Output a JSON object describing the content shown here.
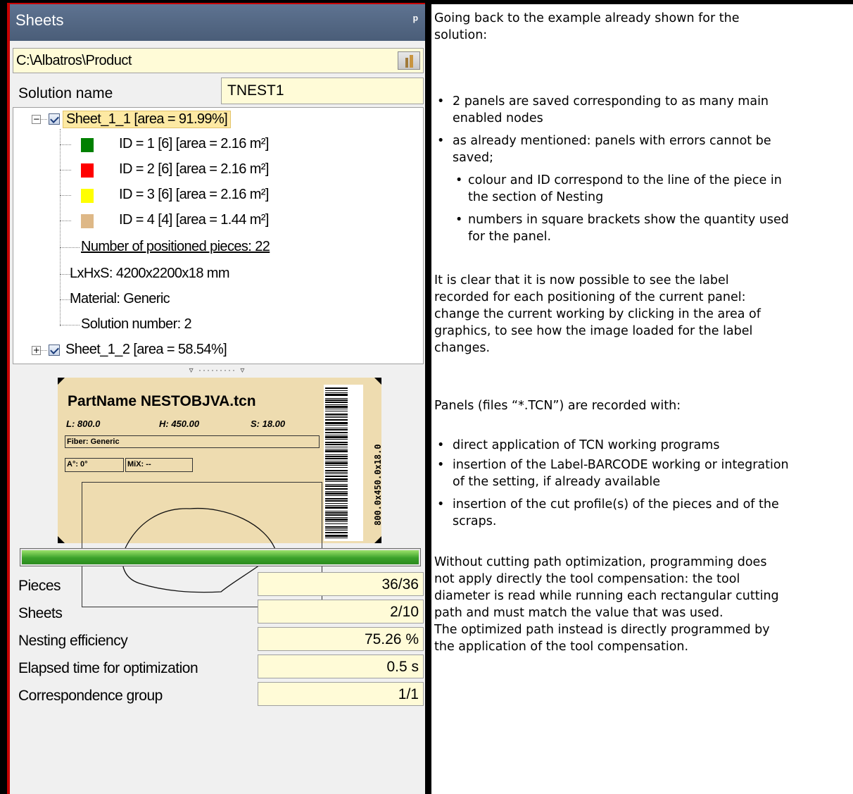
{
  "panel": {
    "title": "Sheets",
    "pin_icon": "pin-icon",
    "path": "C:\\Albatros\\Product",
    "solution_name_label": "Solution name",
    "solution_name_value": "TNEST1",
    "tree": {
      "sheet1": "Sheet_1_1 [area = 91.99%]",
      "pieces": [
        {
          "label": "ID = 1 [6] [area = 2.16 m²]",
          "color": "#008000"
        },
        {
          "label": "ID = 2 [6] [area = 2.16 m²]",
          "color": "#ff0000"
        },
        {
          "label": "ID = 3 [6] [area = 2.16 m²]",
          "color": "#ffff00"
        },
        {
          "label": "ID = 4 [4] [area = 1.44 m²]",
          "color": "#deb887"
        }
      ],
      "positioned": "Number of positioned pieces: 22",
      "lxhxs": "LxHxS: 4200x2200x18  mm",
      "material": "Material: Generic",
      "solution_number": "Solution number: 2",
      "sheet2": "Sheet_1_2 [area = 58.54%]"
    },
    "label_preview": {
      "part_name": "PartName NESTOBJVA.tcn",
      "l": "L: 800.0",
      "h": "H: 450.00",
      "s": "S: 18.00",
      "fiber": "Fiber: Generic",
      "angle": "A°: 0°",
      "mix": "MiX: --",
      "barcode_text": "800.0x450.0x18.0"
    },
    "progress": 1.0,
    "stats": [
      {
        "label": "Pieces",
        "value": "36/36"
      },
      {
        "label": "Sheets",
        "value": "2/10"
      },
      {
        "label": "Nesting efficiency",
        "value": "75.26 %"
      },
      {
        "label": "Elapsed time for optimization",
        "value": "0.5 s"
      },
      {
        "label": "Correspondence group",
        "value": "1/1"
      }
    ]
  },
  "doc": {
    "intro_1": "Going back to the example already shown for the",
    "intro_2": "solution:",
    "b1_1": "2 panels are saved corresponding to as many main",
    "b1_2": "enabled nodes",
    "b2_1": "as already mentioned: panels with errors cannot be",
    "b2_2": "saved;",
    "s1_1": "colour and ID correspond to the line of the piece in",
    "s1_2": "the section of Nesting",
    "s2_1": "numbers in square brackets show the quantity used",
    "s2_2": "for the panel.",
    "p2_1": "It is clear that it is now possible to see the label",
    "p2_2": "recorded for each positioning of the current panel:",
    "p2_3": "change the current working by clicking in the area of",
    "p2_4": "graphics, to see how the image loaded for the label",
    "p2_5": "changes.",
    "p3": "Panels (files “*.TCN”) are recorded with:",
    "c1": "direct application of TCN working programs",
    "c2_1": "insertion of the Label-BARCODE working or integration",
    "c2_2": "of the setting, if already available",
    "c3_1": "insertion of the cut profile(s) of the pieces and of the",
    "c3_2": "scraps.",
    "p4_1": "Without cutting path optimization, programming does",
    "p4_2": "not apply directly the tool compensation: the tool",
    "p4_3": "diameter is read while running each rectangular cutting",
    "p4_4": "path and must match the value that was used.",
    "p4_5": "The optimized path instead is directly programmed by",
    "p4_6": "the application of the tool compensation."
  }
}
